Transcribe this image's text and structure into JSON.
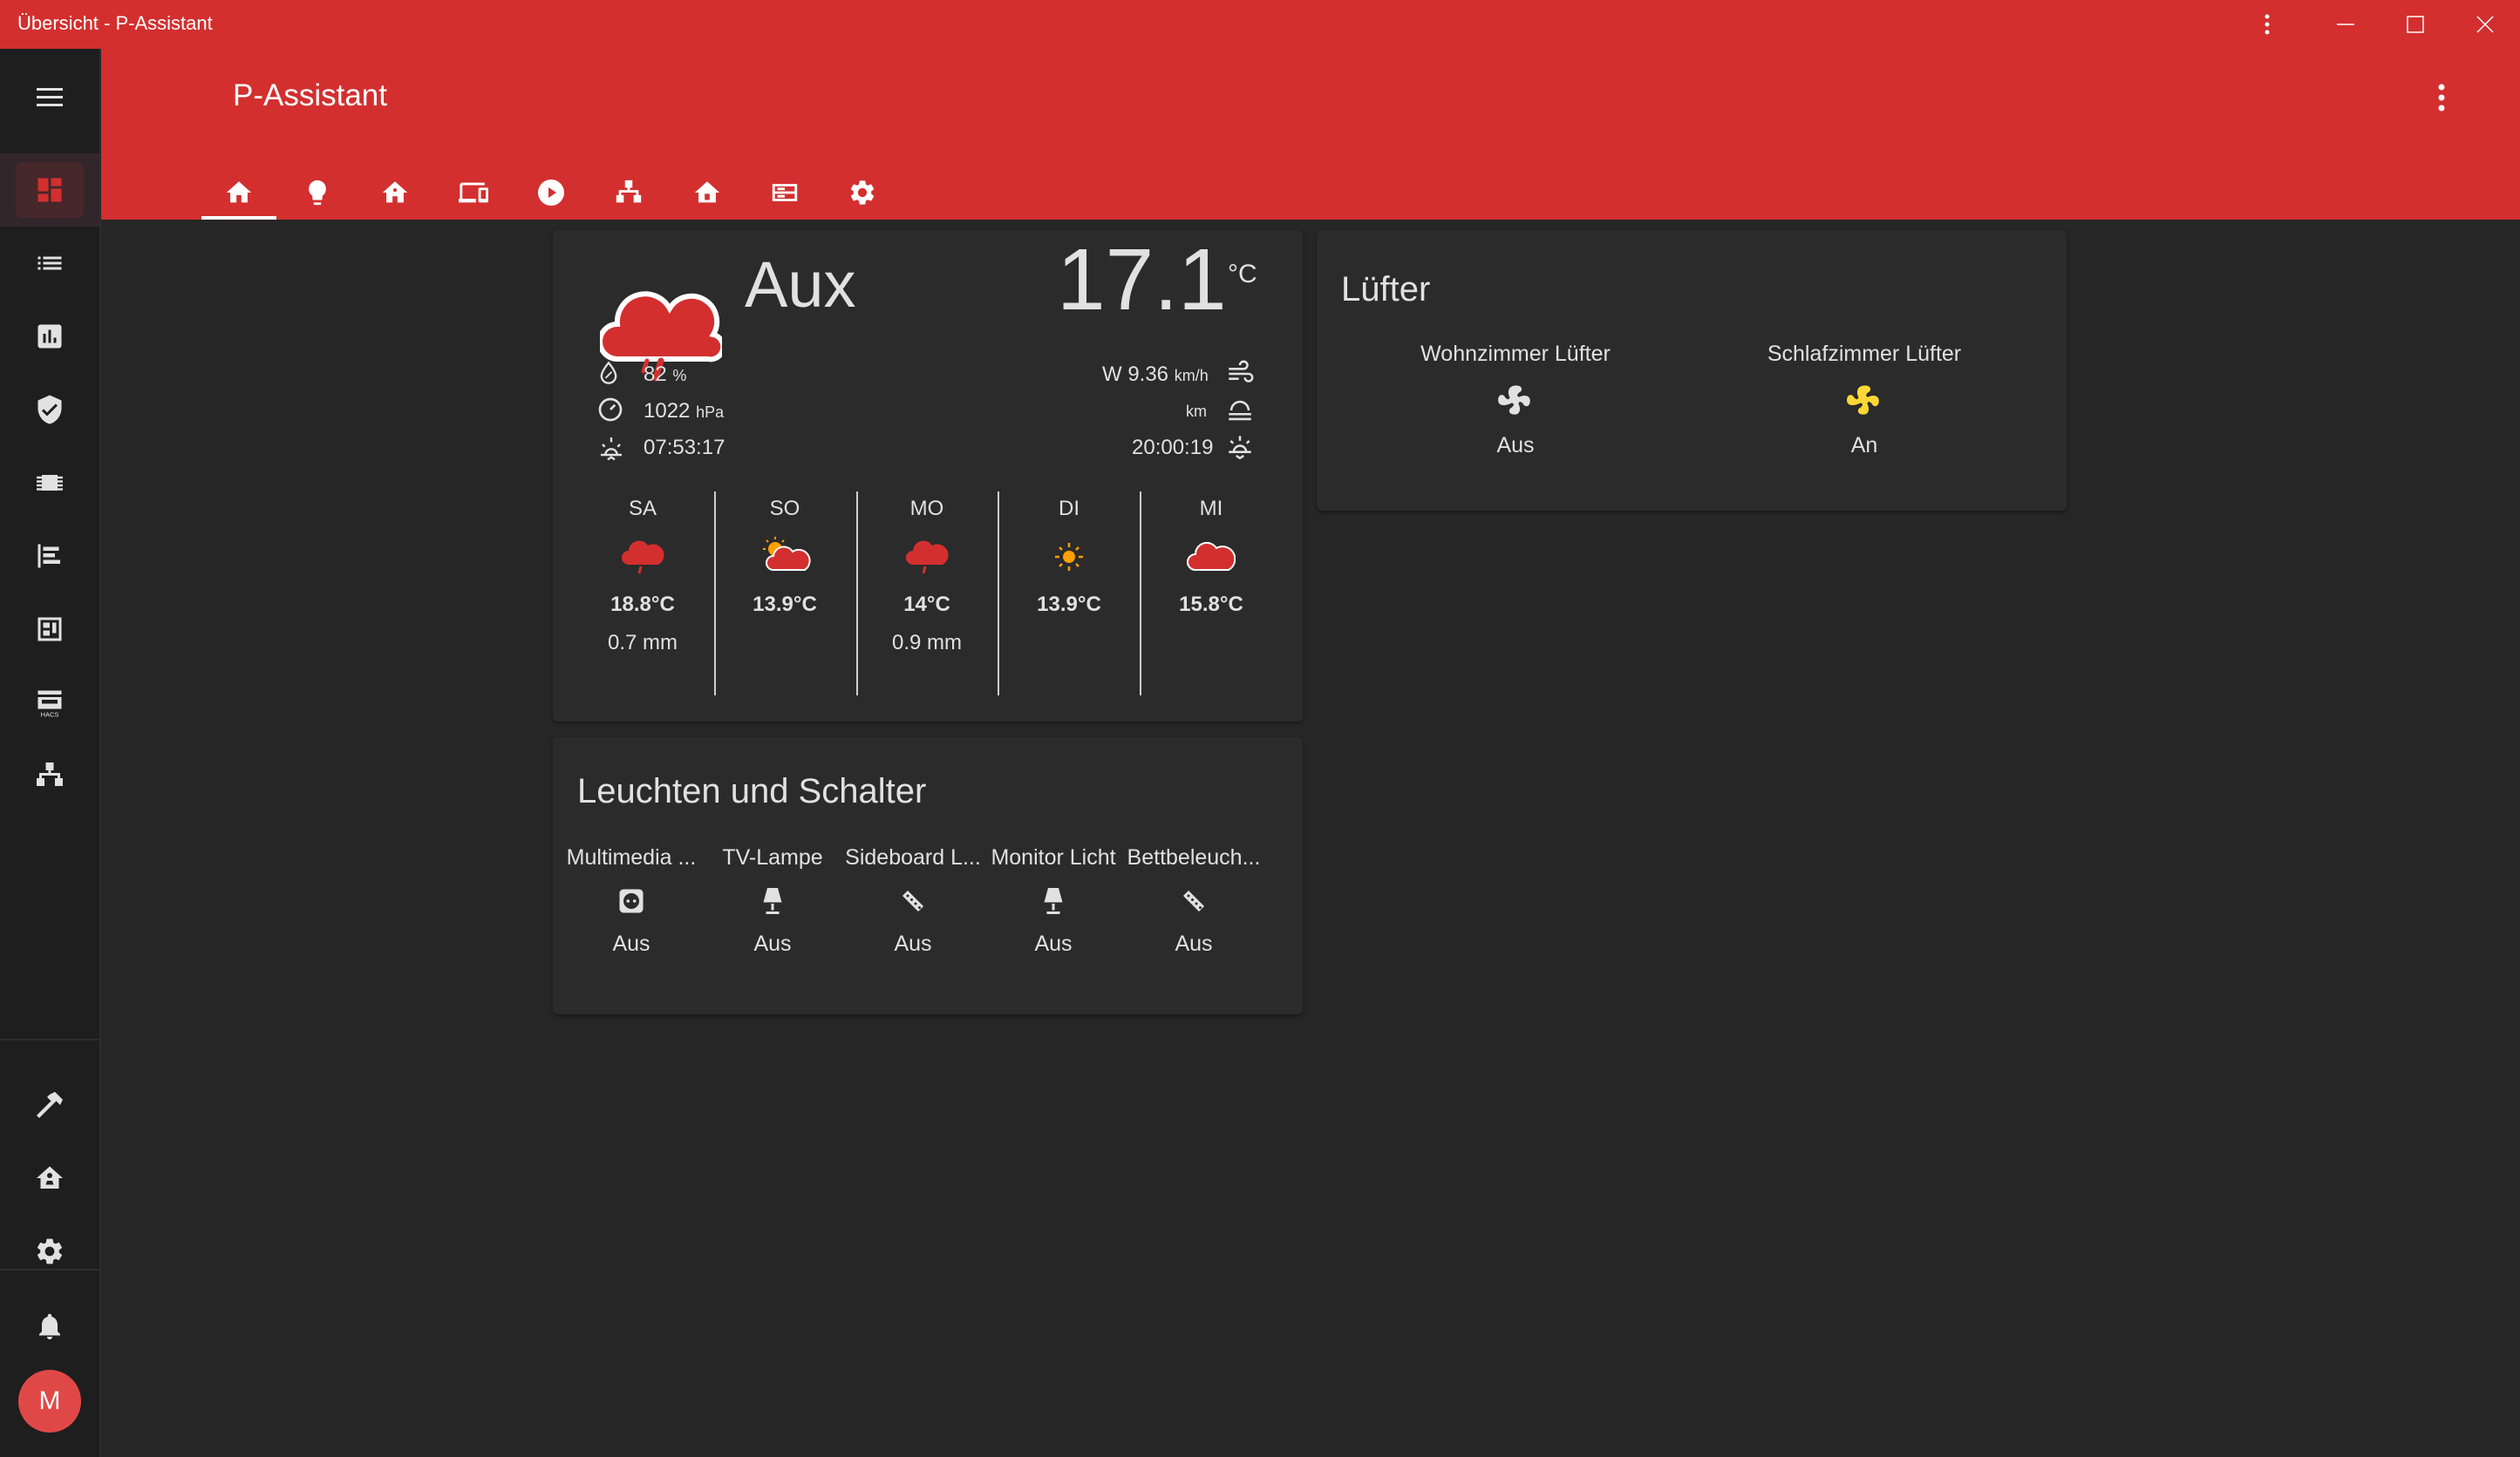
{
  "window": {
    "title": "Übersicht - P-Assistant"
  },
  "header": {
    "title": "P-Assistant",
    "tabs": [
      "home-icon",
      "lightbulb-icon",
      "house-icon",
      "devices-icon",
      "play-icon",
      "network-icon",
      "home-outline-icon",
      "server-icon",
      "gear-icon"
    ]
  },
  "sidebar": {
    "items": [
      "dashboard-icon",
      "list-icon",
      "chart-icon",
      "shield-check-icon",
      "chip-icon",
      "timeline-icon",
      "floorplan-icon",
      "hacs-icon",
      "sitemap-icon"
    ],
    "bottom_items": [
      "hammer-icon",
      "home-automation-icon",
      "settings-icon"
    ],
    "notification_icon": "bell-icon",
    "avatar_initial": "M"
  },
  "weather": {
    "location": "Aux",
    "temperature": "17.1",
    "temp_unit": "°C",
    "humidity": "82",
    "humidity_unit": "%",
    "pressure": "1022",
    "pressure_unit": "hPa",
    "sunrise": "07:53:17",
    "wind": "W 9.36",
    "wind_unit": "km/h",
    "visibility_unit": "km",
    "sunset": "20:00:19",
    "forecast": [
      {
        "day": "SA",
        "temp": "18.8°C",
        "precip": "0.7 mm",
        "icon": "rainy-cloud-icon"
      },
      {
        "day": "SO",
        "temp": "13.9°C",
        "precip": "",
        "icon": "partly-sunny-icon"
      },
      {
        "day": "MO",
        "temp": "14°C",
        "precip": "0.9 mm",
        "icon": "rainy-cloud-icon"
      },
      {
        "day": "DI",
        "temp": "13.9°C",
        "precip": "",
        "icon": "sun-icon"
      },
      {
        "day": "MI",
        "temp": "15.8°C",
        "precip": "",
        "icon": "cloudy-icon"
      }
    ]
  },
  "lights": {
    "title": "Leuchten und Schalter",
    "entities": [
      {
        "name": "Multimedia ...",
        "state": "Aus",
        "icon": "power-socket-icon"
      },
      {
        "name": "TV-Lampe",
        "state": "Aus",
        "icon": "lamp-icon"
      },
      {
        "name": "Sideboard L...",
        "state": "Aus",
        "icon": "led-strip-icon"
      },
      {
        "name": "Monitor Licht",
        "state": "Aus",
        "icon": "lamp-icon"
      },
      {
        "name": "Bettbeleuch...",
        "state": "Aus",
        "icon": "led-strip-icon"
      }
    ]
  },
  "fans": {
    "title": "Lüfter",
    "entities": [
      {
        "name": "Wohnzimmer Lüfter",
        "state": "Aus",
        "icon": "fan-icon"
      },
      {
        "name": "Schlafzimmer Lüfter",
        "state": "An",
        "icon": "fan-icon"
      }
    ]
  },
  "colors": {
    "primary": "#d32f2f",
    "background": "#262626",
    "card": "#2b2b2b",
    "text": "#e1e1e1",
    "fan_on": "#fdd835",
    "sun": "#ffa000"
  }
}
